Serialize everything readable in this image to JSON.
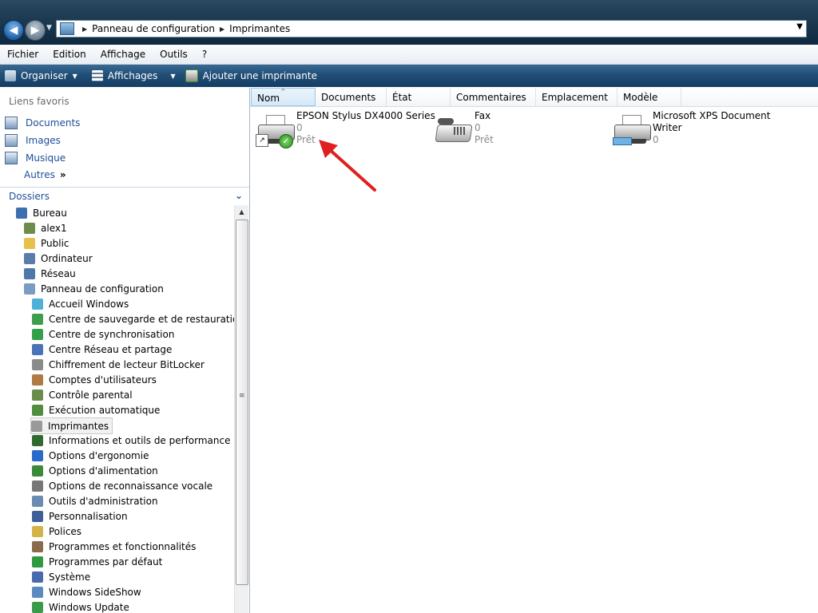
{
  "address": {
    "crumbs": [
      "Panneau de configuration",
      "Imprimantes"
    ]
  },
  "menubar": [
    "Fichier",
    "Edition",
    "Affichage",
    "Outils",
    "?"
  ],
  "toolbar": {
    "organize": "Organiser",
    "views": "Affichages",
    "add_printer": "Ajouter une imprimante"
  },
  "favorites": {
    "title": "Liens favoris",
    "items": [
      "Documents",
      "Images",
      "Musique"
    ],
    "more": "Autres",
    "more_glyph": "»"
  },
  "folders": {
    "title": "Dossiers",
    "tree": [
      {
        "label": "Bureau",
        "icon": "desktop-icon"
      },
      {
        "label": "alex1",
        "icon": "user-folder-icon"
      },
      {
        "label": "Public",
        "icon": "folder-icon"
      },
      {
        "label": "Ordinateur",
        "icon": "computer-icon"
      },
      {
        "label": "Réseau",
        "icon": "network-icon"
      },
      {
        "label": "Panneau de configuration",
        "icon": "control-panel-icon"
      },
      {
        "label": "Accueil Windows",
        "icon": "welcome-icon"
      },
      {
        "label": "Centre de sauvegarde et de restauration",
        "icon": "backup-icon"
      },
      {
        "label": "Centre de synchronisation",
        "icon": "sync-icon"
      },
      {
        "label": "Centre Réseau et partage",
        "icon": "network-sharing-icon"
      },
      {
        "label": "Chiffrement de lecteur BitLocker",
        "icon": "bitlocker-icon"
      },
      {
        "label": "Comptes d'utilisateurs",
        "icon": "users-icon"
      },
      {
        "label": "Contrôle parental",
        "icon": "parental-control-icon"
      },
      {
        "label": "Exécution automatique",
        "icon": "autoplay-icon"
      },
      {
        "label": "Imprimantes",
        "icon": "printers-icon"
      },
      {
        "label": "Informations et outils de performance",
        "icon": "performance-icon"
      },
      {
        "label": "Options d'ergonomie",
        "icon": "ease-of-access-icon"
      },
      {
        "label": "Options d'alimentation",
        "icon": "power-icon"
      },
      {
        "label": "Options de reconnaissance vocale",
        "icon": "microphone-icon"
      },
      {
        "label": "Outils d'administration",
        "icon": "admin-tools-icon"
      },
      {
        "label": "Personnalisation",
        "icon": "personalization-icon"
      },
      {
        "label": "Polices",
        "icon": "fonts-icon"
      },
      {
        "label": "Programmes et fonctionnalités",
        "icon": "programs-icon"
      },
      {
        "label": "Programmes par défaut",
        "icon": "default-programs-icon"
      },
      {
        "label": "Système",
        "icon": "system-icon"
      },
      {
        "label": "Windows SideShow",
        "icon": "sideshow-icon"
      },
      {
        "label": "Windows Update",
        "icon": "windows-update-icon"
      }
    ],
    "selected": "Imprimantes"
  },
  "columns": [
    "Nom",
    "Documents",
    "État",
    "Commentaires",
    "Emplacement",
    "Modèle"
  ],
  "printers": [
    {
      "name": "EPSON Stylus DX4000 Series",
      "docs": "0",
      "status": "Prêt",
      "icon": "printer-default-icon"
    },
    {
      "name": "Fax",
      "docs": "0",
      "status": "Prêt",
      "icon": "fax-icon"
    },
    {
      "name_line1": "Microsoft XPS Document",
      "name_line2": "Writer",
      "docs": "0",
      "icon": "xps-printer-icon"
    }
  ],
  "colors": {
    "accent_link": "#1e4e9a",
    "toolbar": "#214e77",
    "annotation_arrow": "#e02020"
  }
}
